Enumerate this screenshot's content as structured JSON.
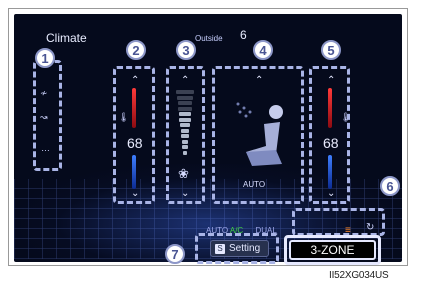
{
  "screen": {
    "title": "Climate",
    "outside_label": "Outside",
    "outside_temp": "6",
    "seat_view_label": "AUTO"
  },
  "left_panel": {
    "icons": [
      "seat-heat-icon",
      "steering-heat-icon",
      "more-dots-icon"
    ],
    "more_label": "…"
  },
  "driver": {
    "temp": "68"
  },
  "passenger": {
    "temp": "68"
  },
  "fan": {
    "icon": "fan-icon",
    "glyph": "❀",
    "level": 0.65
  },
  "status": {
    "auto": "AUTO",
    "ac": "A/C",
    "dual": "DUAL"
  },
  "buttons": {
    "setting": "Setting",
    "setting_icon": "S",
    "zone": "3-ZONE"
  },
  "callouts": [
    "1",
    "2",
    "3",
    "4",
    "5",
    "6",
    "7"
  ],
  "caption": "II52XG034US",
  "colors": {
    "background": "#050a1c",
    "accent": "#a9b4e6",
    "ac_on": "#40d040",
    "hot": "#ff3a3a",
    "cold": "#3f7fff"
  }
}
